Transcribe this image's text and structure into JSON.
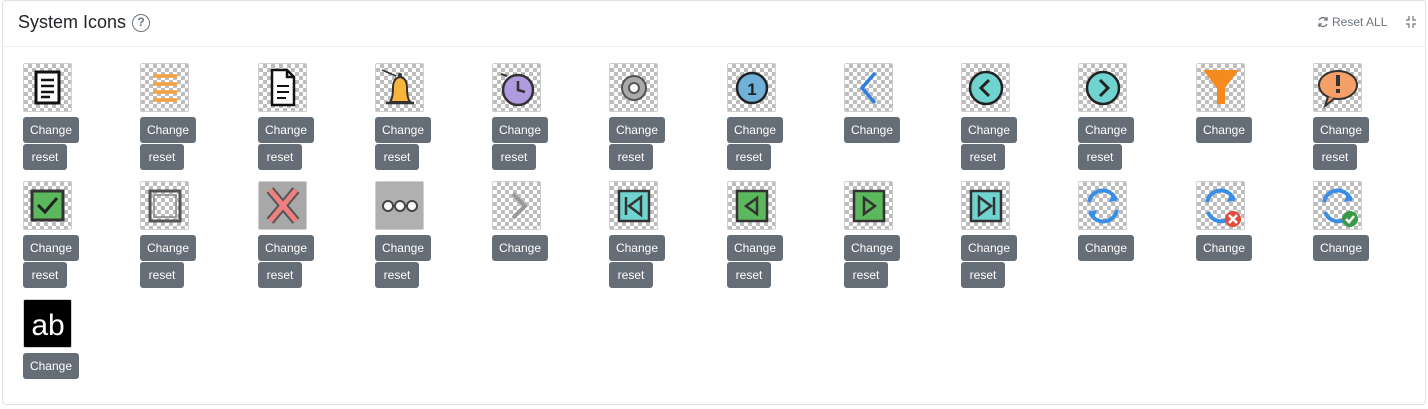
{
  "header": {
    "title": "System Icons",
    "help_glyph": "?",
    "reset_all_label": "Reset ALL"
  },
  "buttons": {
    "change": "Change",
    "reset": "reset"
  },
  "icons": [
    {
      "name": "document-list-icon",
      "row": 0,
      "col": 0,
      "has_reset": true
    },
    {
      "name": "menu-lines-icon",
      "row": 0,
      "col": 1,
      "has_reset": true
    },
    {
      "name": "document-icon",
      "row": 0,
      "col": 2,
      "has_reset": true
    },
    {
      "name": "bell-icon",
      "row": 0,
      "col": 3,
      "has_reset": true
    },
    {
      "name": "clock-icon",
      "row": 0,
      "col": 4,
      "has_reset": true
    },
    {
      "name": "gear-icon",
      "row": 0,
      "col": 5,
      "has_reset": true
    },
    {
      "name": "info-icon",
      "row": 0,
      "col": 6,
      "has_reset": true
    },
    {
      "name": "chevron-left-icon",
      "row": 0,
      "col": 7,
      "has_reset": false
    },
    {
      "name": "circle-left-icon",
      "row": 0,
      "col": 8,
      "has_reset": true
    },
    {
      "name": "circle-right-icon",
      "row": 0,
      "col": 9,
      "has_reset": true
    },
    {
      "name": "filter-icon",
      "row": 0,
      "col": 10,
      "has_reset": false
    },
    {
      "name": "alert-bubble-icon",
      "row": 0,
      "col": 11,
      "has_reset": true
    },
    {
      "name": "checkbox-checked-icon",
      "row": 1,
      "col": 0,
      "has_reset": true
    },
    {
      "name": "checkbox-empty-icon",
      "row": 1,
      "col": 1,
      "has_reset": true
    },
    {
      "name": "close-x-icon",
      "row": 1,
      "col": 2,
      "has_reset": true
    },
    {
      "name": "more-dots-icon",
      "row": 1,
      "col": 3,
      "has_reset": true
    },
    {
      "name": "chevron-right-gray-icon",
      "row": 1,
      "col": 4,
      "has_reset": false
    },
    {
      "name": "first-page-icon",
      "row": 1,
      "col": 5,
      "has_reset": true
    },
    {
      "name": "previous-page-icon",
      "row": 1,
      "col": 6,
      "has_reset": true
    },
    {
      "name": "next-page-icon",
      "row": 1,
      "col": 7,
      "has_reset": true
    },
    {
      "name": "last-page-icon",
      "row": 1,
      "col": 8,
      "has_reset": true
    },
    {
      "name": "refresh-icon",
      "row": 1,
      "col": 9,
      "has_reset": false
    },
    {
      "name": "refresh-error-icon",
      "row": 1,
      "col": 10,
      "has_reset": false
    },
    {
      "name": "refresh-success-icon",
      "row": 1,
      "col": 11,
      "has_reset": false
    },
    {
      "name": "text-ab-icon",
      "row": 2,
      "col": 0,
      "has_reset": false
    }
  ],
  "colors": {
    "button_bg": "#656d76",
    "orange": "#f5a041",
    "blue": "#3a8ee6",
    "teal": "#6fd3d0",
    "green": "#5cb85c",
    "purple": "#b09ae0",
    "red": "#e04b3c"
  }
}
